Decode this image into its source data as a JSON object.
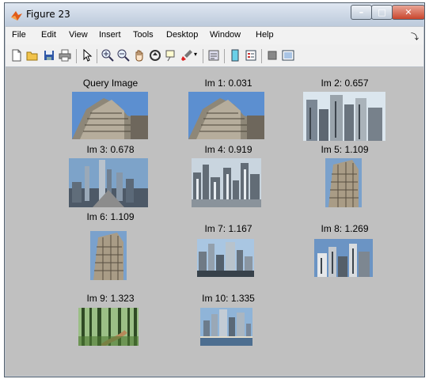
{
  "window": {
    "title": "Figure 23"
  },
  "menu": [
    "File",
    "Edit",
    "View",
    "Insert",
    "Tools",
    "Desktop",
    "Window",
    "Help"
  ],
  "toolbar": [
    "new-figure-icon",
    "open-file-icon",
    "save-icon",
    "print-icon",
    "pointer-icon",
    "zoom-in-icon",
    "zoom-out-icon",
    "pan-icon",
    "rotate-3d-icon",
    "data-cursor-icon",
    "brush-icon",
    "link-plot-icon",
    "colorbar-icon",
    "legend-icon",
    "hide-plot-tools-icon",
    "show-plot-tools-icon"
  ],
  "images": [
    {
      "label": "Query Image"
    },
    {
      "label": "Im 1: 0.031"
    },
    {
      "label": "Im 2: 0.657"
    },
    {
      "label": "Im 3: 0.678"
    },
    {
      "label": "Im 4: 0.919"
    },
    {
      "label": "Im 5: 1.109"
    },
    {
      "label": "Im 6: 1.109"
    },
    {
      "label": "Im 7: 1.167"
    },
    {
      "label": "Im 8: 1.269"
    },
    {
      "label": "Im 9: 1.323"
    },
    {
      "label": "Im 10: 1.335"
    }
  ]
}
